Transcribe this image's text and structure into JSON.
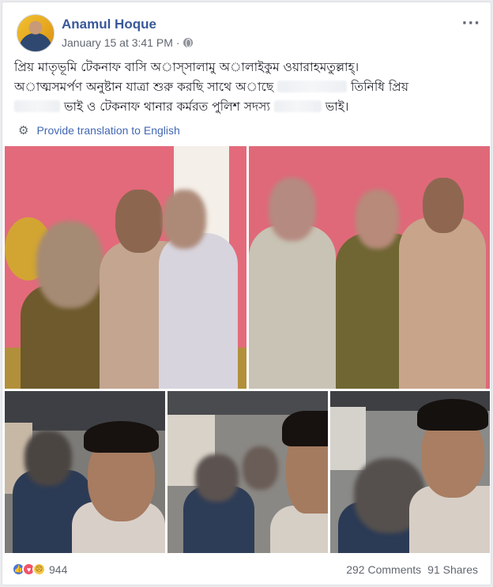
{
  "post": {
    "author": "Anamul Hoque",
    "timestamp": "January 15 at 3:41 PM",
    "separator": "·",
    "privacy_icon": "globe-icon",
    "more_label": "···",
    "text_line1": "প্রিয় মাতৃভূমি টেকনাফ বাসি অাস্সালামু অালাইকুম ওয়ারাহমতুল্লাহ্।",
    "text_line2a": "অাত্মসমর্পণ অনুষ্টান যাত্রা শুরু করছি সাথে অাছে",
    "text_line2b": "তিনিধি প্রিয়",
    "text_line3a": "ভাই ও টেকনাফ থানার কর্মরত পুলিশ সদস্য",
    "text_line3b": "ভাই।",
    "translate_icon": "gear-icon",
    "translate_label": "Provide translation to English"
  },
  "footer": {
    "reaction_icons": [
      "like-icon",
      "love-icon",
      "sad-icon"
    ],
    "reaction_count": "944",
    "comments": "292 Comments",
    "shares": "91 Shares"
  },
  "colors": {
    "link": "#385898",
    "translate_link": "#4267b2",
    "wall_pink": "#e36a7b",
    "like": "#4a76d9",
    "love": "#f25268",
    "sad": "#f7c648"
  }
}
